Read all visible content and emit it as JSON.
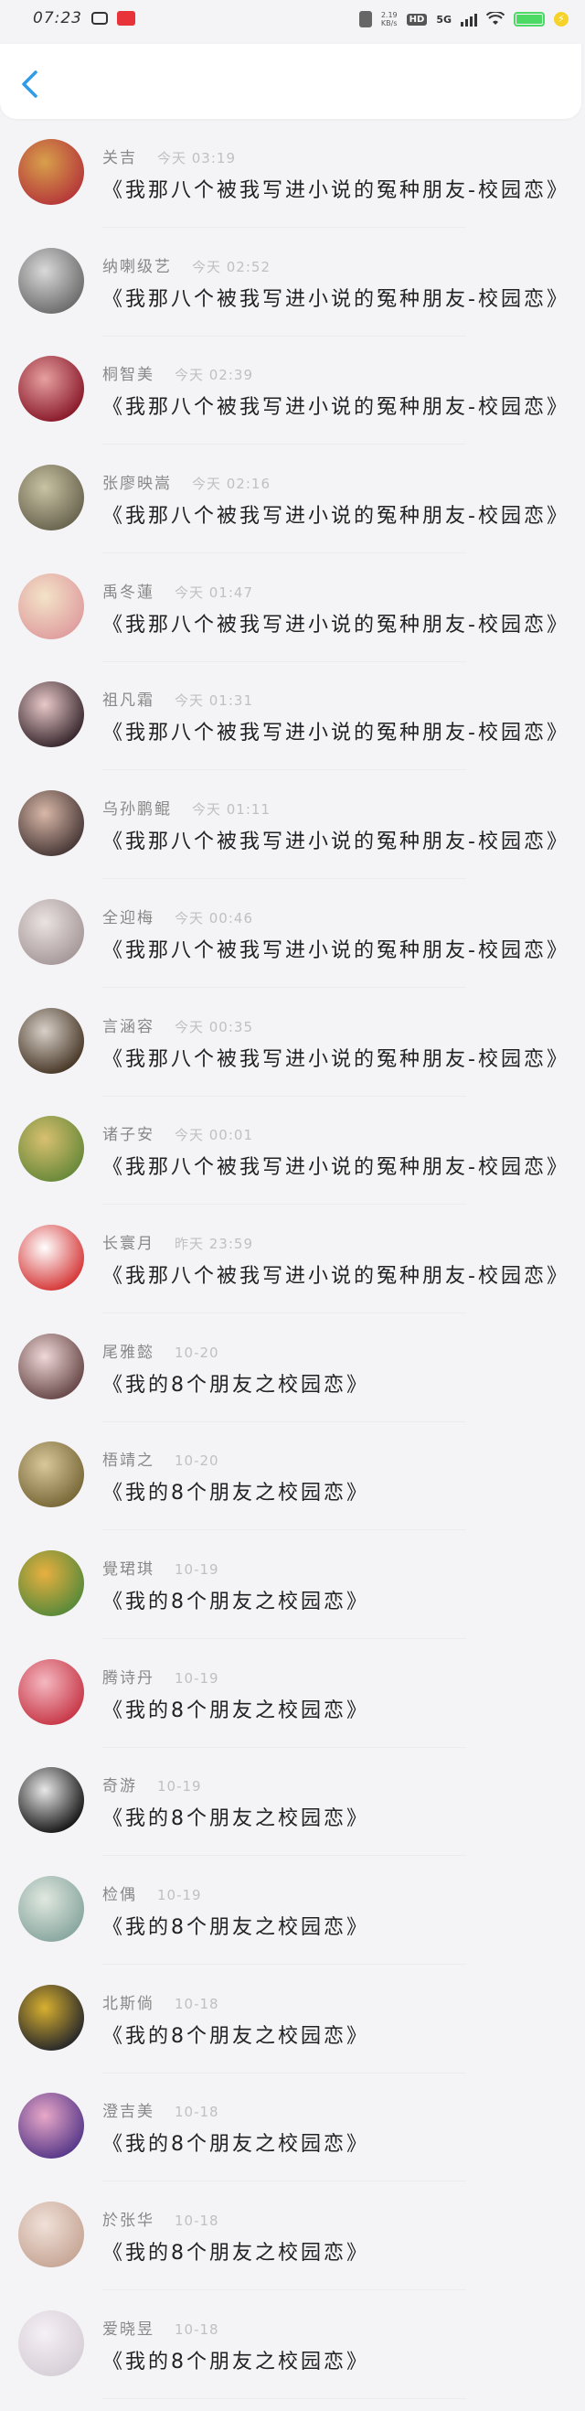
{
  "status_bar": {
    "time": "07:23",
    "network_speed": "2.19\nKB/s",
    "hd": "HD",
    "signal": "5G",
    "charge_symbol": "⚡"
  },
  "header": {
    "back_icon": "chevron-left-icon"
  },
  "colors": {
    "accent": "#2f9be8",
    "battery": "#4cd964"
  },
  "items": [
    {
      "name": "关吉",
      "time": "今天 03:19",
      "title": "《我那八个被我写进小说的冤种朋友-校园恋》",
      "avatar": [
        "#b63a3a",
        "#d8a04b"
      ]
    },
    {
      "name": "纳喇级艺",
      "time": "今天 02:52",
      "title": "《我那八个被我写进小说的冤种朋友-校园恋》",
      "avatar": [
        "#6e6e6e",
        "#d9d9d9"
      ]
    },
    {
      "name": "桐智美",
      "time": "今天 02:39",
      "title": "《我那八个被我写进小说的冤种朋友-校园恋》",
      "avatar": [
        "#8b1c2c",
        "#e6a0a0"
      ]
    },
    {
      "name": "张廖映嵩",
      "time": "今天 02:16",
      "title": "《我那八个被我写进小说的冤种朋友-校园恋》",
      "avatar": [
        "#6b6650",
        "#c9c3a4"
      ]
    },
    {
      "name": "禹冬蓮",
      "time": "今天 01:47",
      "title": "《我那八个被我写进小说的冤种朋友-校园恋》",
      "avatar": [
        "#e0a0a0",
        "#f3e3c8"
      ]
    },
    {
      "name": "祖凡霜",
      "time": "今天 01:31",
      "title": "《我那八个被我写进小说的冤种朋友-校园恋》",
      "avatar": [
        "#3a2a30",
        "#e9c9c9"
      ]
    },
    {
      "name": "乌孙鹏鲲",
      "time": "今天 01:11",
      "title": "《我那八个被我写进小说的冤种朋友-校园恋》",
      "avatar": [
        "#4a3a38",
        "#d9b8a8"
      ]
    },
    {
      "name": "全迎梅",
      "time": "今天 00:46",
      "title": "《我那八个被我写进小说的冤种朋友-校园恋》",
      "avatar": [
        "#a89a9a",
        "#eae2e2"
      ]
    },
    {
      "name": "言涵容",
      "time": "今天 00:35",
      "title": "《我那八个被我写进小说的冤种朋友-校园恋》",
      "avatar": [
        "#4a3a2a",
        "#d8d0c8"
      ]
    },
    {
      "name": "诸子安",
      "time": "今天 00:01",
      "title": "《我那八个被我写进小说的冤种朋友-校园恋》",
      "avatar": [
        "#6a8a3a",
        "#d8c070"
      ]
    },
    {
      "name": "长寰月",
      "time": "昨天 23:59",
      "title": "《我那八个被我写进小说的冤种朋友-校园恋》",
      "avatar": [
        "#d63a3a",
        "#ffffff"
      ]
    },
    {
      "name": "尾雅懿",
      "time": "10-20",
      "title": "《我的8个朋友之校园恋》",
      "avatar": [
        "#6a4a4a",
        "#f0d8d8"
      ]
    },
    {
      "name": "梧靖之",
      "time": "10-20",
      "title": "《我的8个朋友之校园恋》",
      "avatar": [
        "#7a6a3a",
        "#d8c89a"
      ]
    },
    {
      "name": "覺珺琪",
      "time": "10-19",
      "title": "《我的8个朋友之校园恋》",
      "avatar": [
        "#5a8a3a",
        "#e8b040"
      ]
    },
    {
      "name": "腾诗丹",
      "time": "10-19",
      "title": "《我的8个朋友之校园恋》",
      "avatar": [
        "#c83a4a",
        "#f4b8c0"
      ]
    },
    {
      "name": "奇游",
      "time": "10-19",
      "title": "《我的8个朋友之校园恋》",
      "avatar": [
        "#1a1a1a",
        "#e8e8e8"
      ]
    },
    {
      "name": "检偶",
      "time": "10-19",
      "title": "《我的8个朋友之校园恋》",
      "avatar": [
        "#8aa8a0",
        "#e0e8e0"
      ]
    },
    {
      "name": "北斯倘",
      "time": "10-18",
      "title": "《我的8个朋友之校园恋》",
      "avatar": [
        "#2a2a2a",
        "#d8b030"
      ]
    },
    {
      "name": "澄吉美",
      "time": "10-18",
      "title": "《我的8个朋友之校园恋》",
      "avatar": [
        "#5a3a8a",
        "#e8a8c8"
      ]
    },
    {
      "name": "於张华",
      "time": "10-18",
      "title": "《我的8个朋友之校园恋》",
      "avatar": [
        "#c8a898",
        "#f0e0d8"
      ]
    },
    {
      "name": "爱晓昱",
      "time": "10-18",
      "title": "《我的8个朋友之校园恋》",
      "avatar": [
        "#d8d0d8",
        "#f4f0f4"
      ]
    }
  ]
}
